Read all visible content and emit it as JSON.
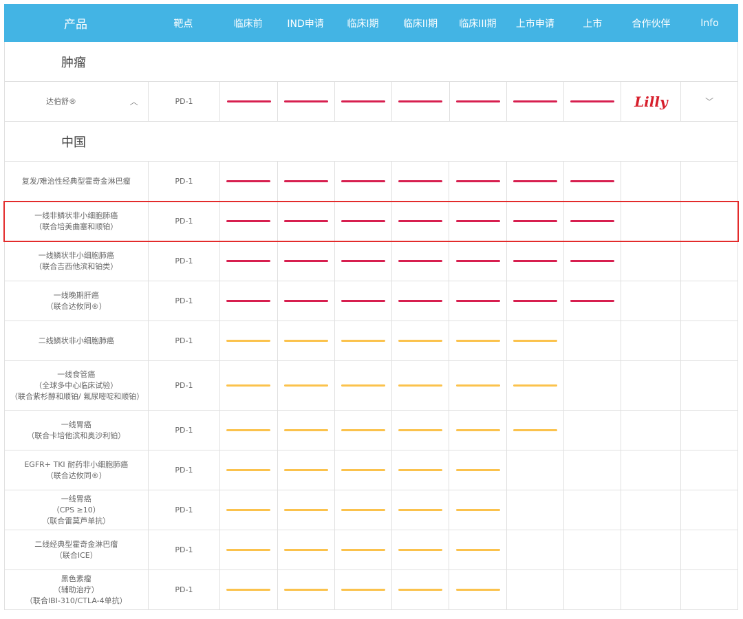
{
  "header": [
    "产品",
    "靶点",
    "临床前",
    "IND申请",
    "临床I期",
    "临床II期",
    "临床III期",
    "上市申请",
    "上市",
    "合作伙伴",
    "Info"
  ],
  "sections": {
    "tumor": "肿瘤",
    "china": "中国"
  },
  "product_row": {
    "name": "达伯舒®",
    "target": "PD-1",
    "stages": 7,
    "partner": "Lilly",
    "expand_icon": "chevron-up-icon",
    "info_icon": "chevron-down-icon"
  },
  "rows": [
    {
      "name": "复发/难治性经典型霍奇金淋巴瘤",
      "target": "PD-1",
      "stages": 7,
      "color": "red"
    },
    {
      "name": "一线非鳞状非小细胞肺癌\n（联合培美曲塞和顺铂）",
      "target": "PD-1",
      "stages": 7,
      "color": "red",
      "highlight": true
    },
    {
      "name": "一线鳞状非小细胞肺癌\n（联合吉西他滨和铂类）",
      "target": "PD-1",
      "stages": 7,
      "color": "red"
    },
    {
      "name": "一线晚期肝癌\n（联合达攸同®）",
      "target": "PD-1",
      "stages": 7,
      "color": "red"
    },
    {
      "name": "二线鳞状非小细胞肺癌",
      "target": "PD-1",
      "stages": 6,
      "color": "yellow"
    },
    {
      "name": "一线食管癌\n（全球多中心临床试验）\n（联合紫杉醇和顺铂/ 氟尿嘧啶和顺铂）",
      "target": "PD-1",
      "stages": 6,
      "color": "yellow"
    },
    {
      "name": "一线胃癌\n（联合卡培他滨和奥沙利铂）",
      "target": "PD-1",
      "stages": 6,
      "color": "yellow"
    },
    {
      "name": "EGFR+ TKI 耐药非小细胞肺癌\n（联合达攸同®）",
      "target": "PD-1",
      "stages": 5,
      "color": "yellow"
    },
    {
      "name": "一线胃癌\n（CPS ≥10）\n（联合雷莫芦单抗）",
      "target": "PD-1",
      "stages": 5,
      "color": "yellow"
    },
    {
      "name": "二线经典型霍奇金淋巴瘤\n（联合ICE）",
      "target": "PD-1",
      "stages": 5,
      "color": "yellow"
    },
    {
      "name": "黑色素瘤\n（辅助治疗）\n（联合IBI-310/CTLA-4单抗）",
      "target": "PD-1",
      "stages": 5,
      "color": "yellow"
    }
  ],
  "colors": {
    "header_bg": "#43b4e4",
    "red": "#d71f4f",
    "yellow": "#fbc24c",
    "highlight": "#e32b2b"
  }
}
